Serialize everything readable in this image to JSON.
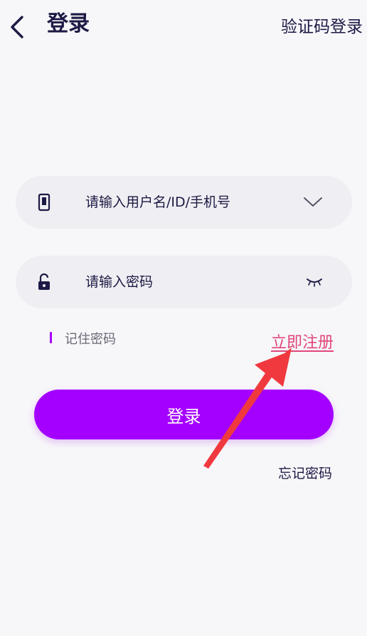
{
  "header": {
    "back_icon": "chevron-left-icon",
    "title": "登录",
    "sms_login_label": "验证码登录"
  },
  "form": {
    "username": {
      "placeholder": "请输入用户名/ID/手机号",
      "value": "",
      "lead_icon": "phone-icon",
      "trail_icon": "chevron-down-icon"
    },
    "password": {
      "placeholder": "请输入密码",
      "value": "",
      "lead_icon": "unlock-icon",
      "trail_icon": "eye-closed-icon"
    },
    "remember_label": "记住密码",
    "register_label": "立即注册",
    "submit_label": "登录",
    "forgot_label": "忘记密码"
  },
  "colors": {
    "background": "#f7f6f9",
    "field_background": "#efeef2",
    "primary": "#a400ff",
    "text": "#1c1a44",
    "register_link": "#e0477a",
    "annotation_arrow": "#f0393e"
  }
}
